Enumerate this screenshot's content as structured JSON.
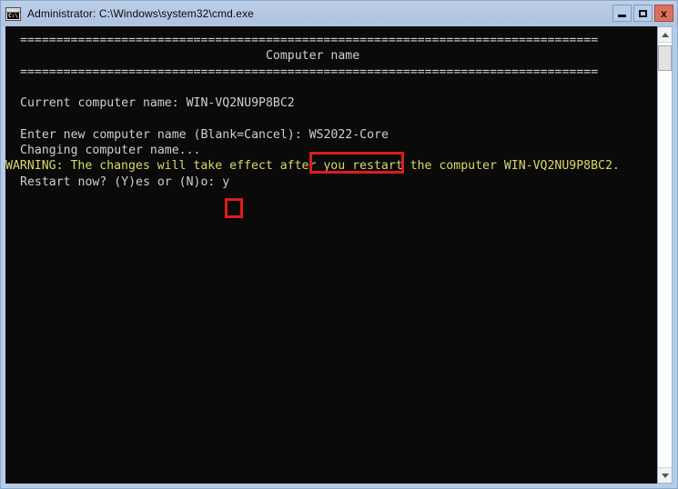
{
  "window": {
    "title": "Administrator: C:\\Windows\\system32\\cmd.exe",
    "icon_name": "cmd-icon",
    "icon_text": "C:\\",
    "controls": {
      "minimize_label": "Minimize",
      "maximize_label": "Maximize",
      "close_label": "x"
    }
  },
  "console": {
    "separator": "================================================================================",
    "heading": "Computer name",
    "heading_indent": 34,
    "lines": [
      {
        "id": "sep-top",
        "text": "================================================================================",
        "color": "plain",
        "indent": true
      },
      {
        "id": "heading",
        "text": "                                  Computer name",
        "color": "plain",
        "indent": true
      },
      {
        "id": "sep-bottom",
        "text": "================================================================================",
        "color": "plain",
        "indent": true
      },
      {
        "id": "blank-1",
        "text": " ",
        "color": "plain",
        "indent": true
      },
      {
        "id": "current-name",
        "text": "Current computer name: WIN-VQ2NU9P8BC2",
        "color": "plain",
        "indent": true
      },
      {
        "id": "blank-2",
        "text": " ",
        "color": "plain",
        "indent": true
      },
      {
        "id": "enter-new-name",
        "text": "Enter new computer name (Blank=Cancel): WS2022-Core",
        "color": "plain",
        "indent": true
      },
      {
        "id": "changing",
        "text": "Changing computer name...",
        "color": "plain",
        "indent": true
      },
      {
        "id": "warning",
        "text": "WARNING: The changes will take effect after you restart the computer WIN-VQ2NU9P8BC2.",
        "color": "warn",
        "indent": false
      },
      {
        "id": "restart-prompt",
        "text": "Restart now? (Y)es or (N)o: y",
        "color": "plain",
        "indent": true
      }
    ],
    "values": {
      "current_computer_name": "WIN-VQ2NU9P8BC2",
      "new_computer_name": "WS2022-Core",
      "restart_answer": "y"
    },
    "colors": {
      "background": "#0a0a0a",
      "text": "#cccccc",
      "warning_text": "#d8d86a",
      "highlight_box": "#e01b1b"
    }
  },
  "scrollbar": {
    "up_arrow_label": "scroll up",
    "down_arrow_label": "scroll down"
  }
}
